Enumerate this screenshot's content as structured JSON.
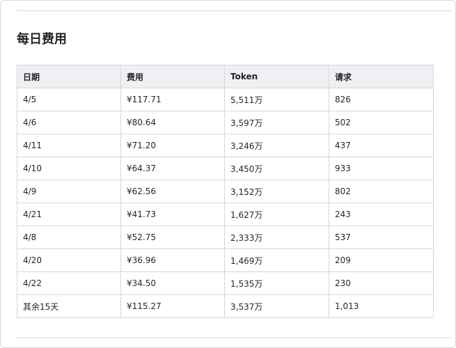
{
  "section": {
    "title": "每日费用"
  },
  "table": {
    "headers": [
      "日期",
      "费用",
      "Token",
      "请求"
    ],
    "rows": [
      [
        "4/5",
        "¥117.71",
        "5,511万",
        "826"
      ],
      [
        "4/6",
        "¥80.64",
        "3,597万",
        "502"
      ],
      [
        "4/11",
        "¥71.20",
        "3,246万",
        "437"
      ],
      [
        "4/10",
        "¥64.37",
        "3,450万",
        "933"
      ],
      [
        "4/9",
        "¥62.56",
        "3,152万",
        "802"
      ],
      [
        "4/21",
        "¥41.73",
        "1,627万",
        "243"
      ],
      [
        "4/8",
        "¥52.75",
        "2,333万",
        "537"
      ],
      [
        "4/20",
        "¥36.96",
        "1,469万",
        "209"
      ],
      [
        "4/22",
        "¥34.50",
        "1,535万",
        "230"
      ],
      [
        "其余15天",
        "¥115.27",
        "3,537万",
        "1,013"
      ]
    ]
  }
}
